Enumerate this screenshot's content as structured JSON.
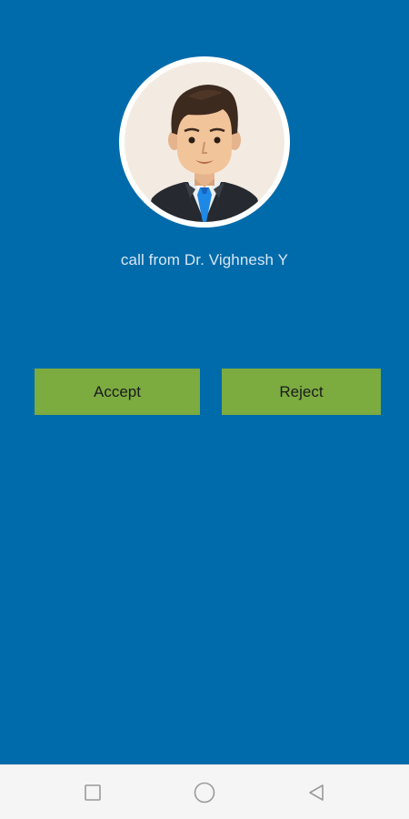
{
  "call": {
    "caller_text": "call from Dr. Vighnesh Y",
    "avatar_icon": "male-doctor-avatar-icon"
  },
  "actions": {
    "accept_label": "Accept",
    "reject_label": "Reject"
  },
  "navbar": {
    "items": [
      {
        "name": "recent-apps",
        "icon": "square-icon"
      },
      {
        "name": "home",
        "icon": "circle-icon"
      },
      {
        "name": "back",
        "icon": "triangle-back-icon"
      }
    ]
  },
  "colors": {
    "background": "#006bab",
    "button": "#7cab40",
    "navbar": "#f5f5f5"
  }
}
